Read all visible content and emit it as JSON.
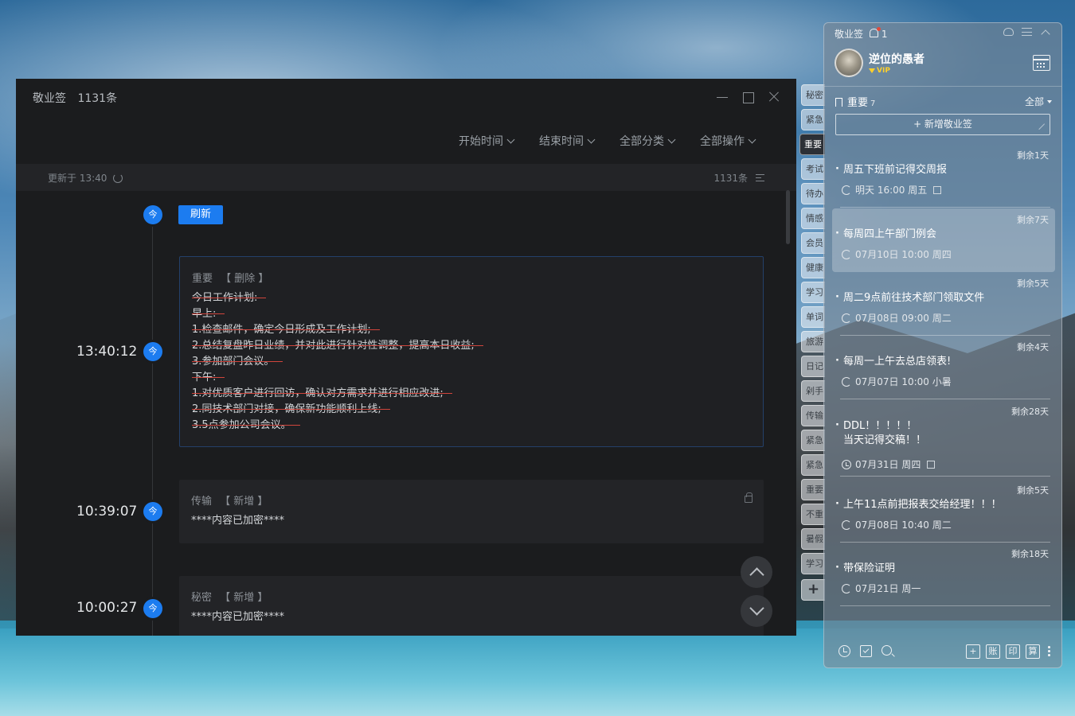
{
  "main_window": {
    "app_name": "敬业签",
    "count": "1131条",
    "filters": [
      "开始时间",
      "结束时间",
      "全部分类",
      "全部操作"
    ],
    "updated": "更新于 13:40",
    "total": "1131条",
    "refresh_button": "刷新",
    "today_badge": "今",
    "entries": [
      {
        "time": "13:40:12",
        "category": "重要",
        "action": "【 删除 】",
        "lines": [
          "今日工作计划:",
          "早上:",
          "1.检查邮件，确定今日形成及工作计划;",
          "2.总结复盘昨日业绩，并对此进行针对性调整，提高本日收益;",
          "3.参加部门会议。",
          "下午:",
          "1.对优质客户进行回访，确认对方需求并进行相应改进;",
          "2.同技术部门对接，确保新功能顺利上线;",
          "3.5点参加公司会议。"
        ]
      },
      {
        "time": "10:39:07",
        "category": "传输",
        "action": "【 新增 】",
        "content": "****内容已加密****"
      },
      {
        "time": "10:00:27",
        "category": "秘密",
        "action": "【 新增 】",
        "content": "****内容已加密****"
      }
    ]
  },
  "side_tabs": [
    "秘密",
    "紧急",
    "重要",
    "考试",
    "待办",
    "情感",
    "会员",
    "健康",
    "学习",
    "单词",
    "旅游",
    "日记",
    "剁手",
    "传输",
    "紧急",
    "紧急",
    "重要",
    "不重",
    "暑假",
    "学习"
  ],
  "side_tabs_add": "+",
  "panel": {
    "app_name": "敬业签",
    "notice_count": "1",
    "user_name": "逆位的愚者",
    "vip": "VIP",
    "category": "重要",
    "category_count": "7",
    "filter_all": "全部",
    "add_new": "+ 新增敬业签",
    "notes": [
      {
        "remain": "剩余1天",
        "title": "周五下班前记得交周报",
        "meta": "明天 16:00 周五",
        "icon": "repeat-icon",
        "doc": true
      },
      {
        "remain": "剩余7天",
        "title": "每周四上午部门例会",
        "meta": "07月10日 10:00 周四",
        "icon": "repeat-icon",
        "doc": false
      },
      {
        "remain": "剩余5天",
        "title": "周二9点前往技术部门领取文件",
        "meta": "07月08日 09:00 周二",
        "icon": "repeat-icon",
        "doc": false
      },
      {
        "remain": "剩余4天",
        "title": "每周一上午去总店领表!",
        "meta": "07月07日 10:00 小暑",
        "icon": "repeat-icon",
        "doc": false
      },
      {
        "remain": "剩余28天",
        "title": "DDL！！！！！",
        "title2": "当天记得交稿！！",
        "meta": "07月31日 周四",
        "icon": "clock-icon",
        "doc": true
      },
      {
        "remain": "剩余5天",
        "title": "上午11点前把报表交给经理！！！",
        "meta": "07月08日 10:40 周二",
        "icon": "repeat-icon",
        "doc": false
      },
      {
        "remain": "剩余18天",
        "title": "带保险证明",
        "meta": "07月21日 周一",
        "icon": "repeat-icon",
        "doc": false
      }
    ],
    "bottom_tools": [
      "+",
      "账",
      "印",
      "算"
    ]
  }
}
